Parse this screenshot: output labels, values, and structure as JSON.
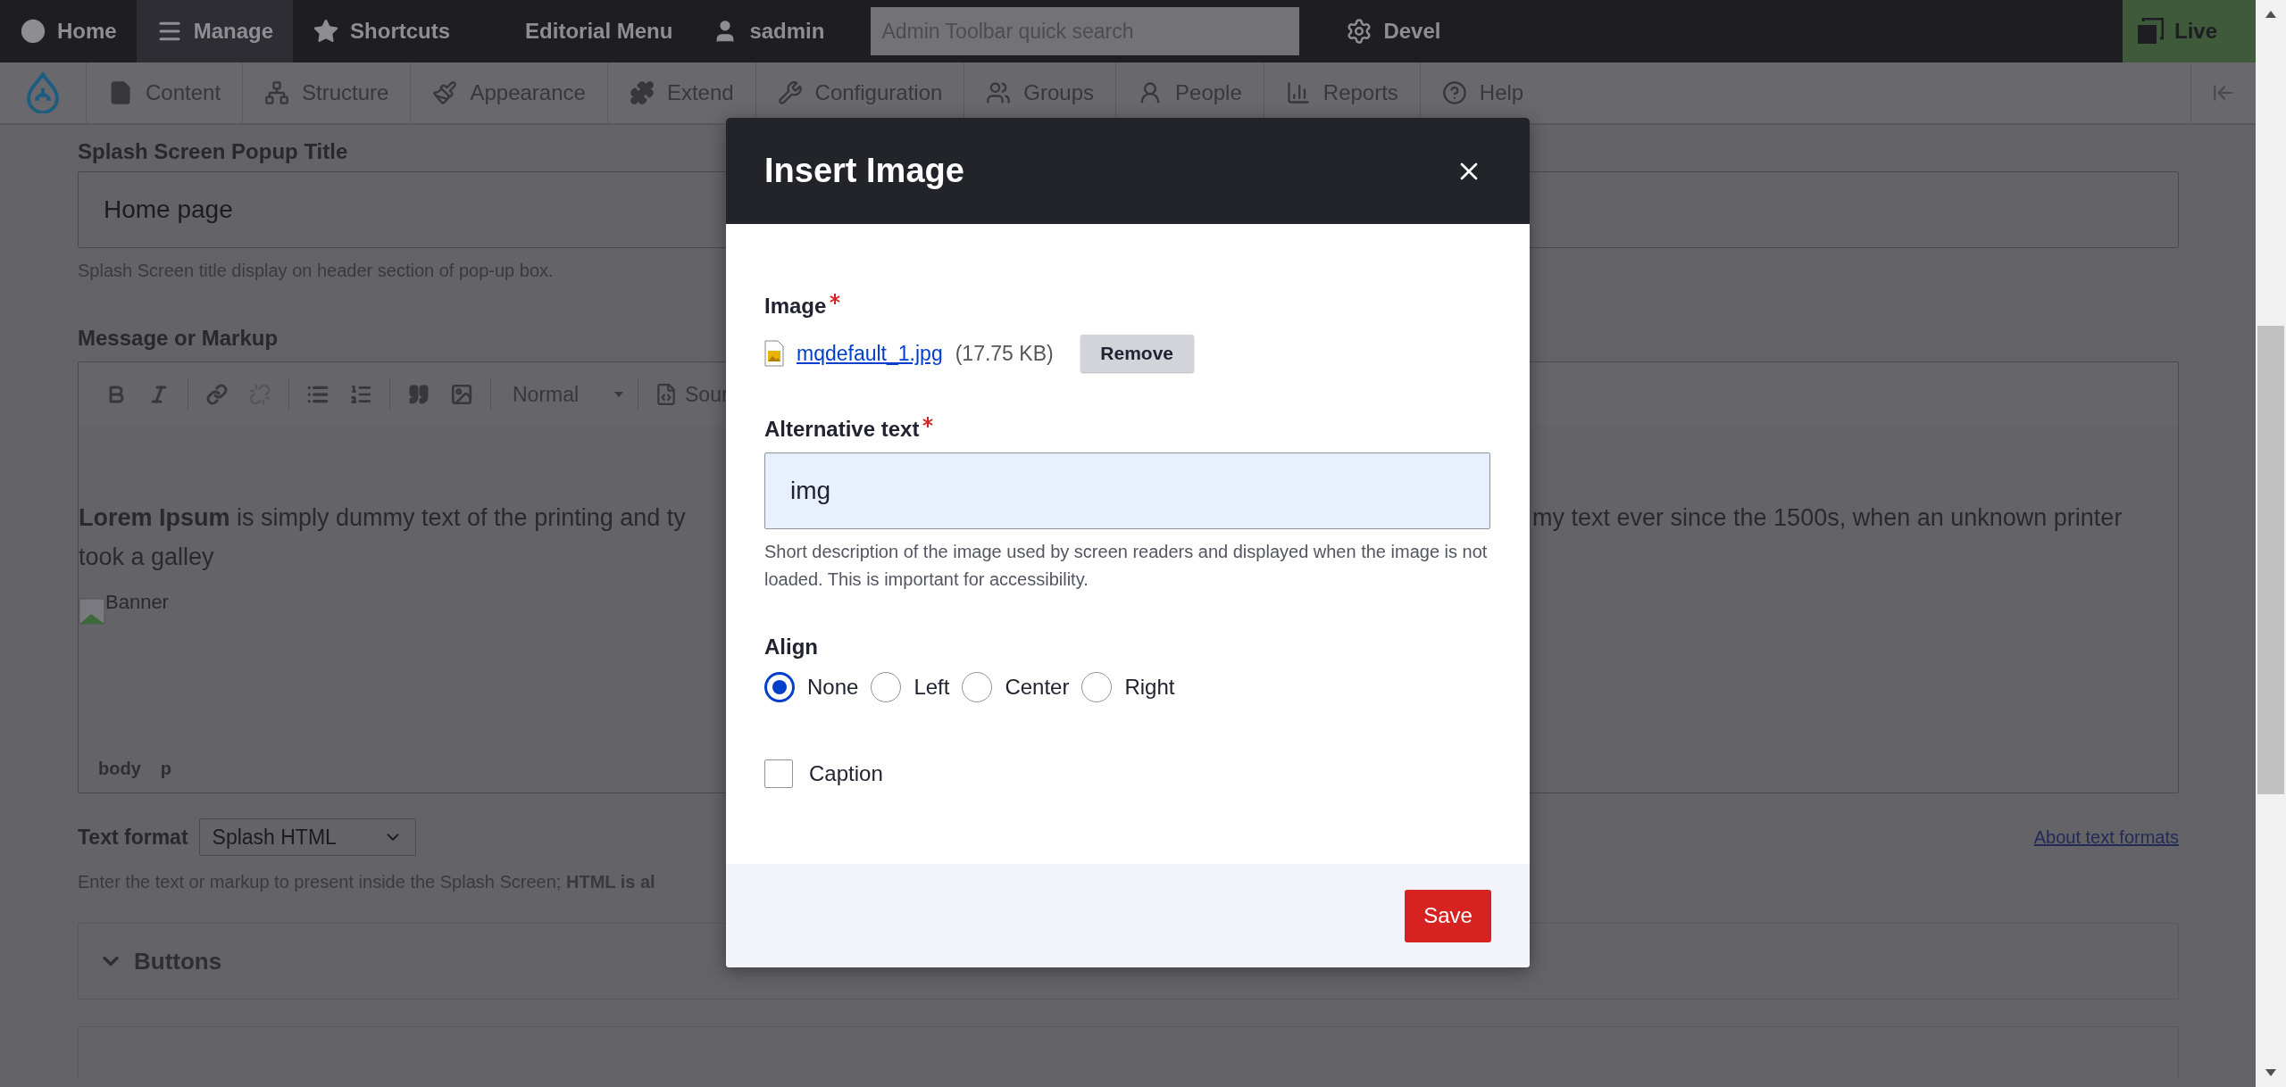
{
  "admin_toolbar": {
    "items": [
      {
        "label": "Home",
        "selected": false
      },
      {
        "label": "Manage",
        "selected": true
      },
      {
        "label": "Shortcuts",
        "selected": false
      },
      {
        "label": "Editorial Menu",
        "selected": false
      },
      {
        "label": "sadmin",
        "selected": false
      }
    ],
    "search": {
      "placeholder": "Admin Toolbar quick search"
    },
    "devel": "Devel",
    "live": "Live"
  },
  "menu": {
    "items": [
      "Content",
      "Structure",
      "Appearance",
      "Extend",
      "Configuration",
      "Groups",
      "People",
      "Reports",
      "Help"
    ]
  },
  "form": {
    "title_field": {
      "label": "Splash Screen Popup Title",
      "value": "Home page",
      "description": "Splash Screen title display on header section of pop-up box."
    },
    "message": {
      "label": "Message or Markup",
      "format": "Normal",
      "source": "Sour",
      "line1_left": "**Lorem Ipsum** is simply dummy text of the printing and ty",
      "line1_right": "my text ever since the 1500s, when an unknown printer",
      "line2": "took a galley",
      "image_alt": "Banner",
      "path": [
        "body",
        "p"
      ]
    },
    "text_format": {
      "label": "Text format",
      "value": "Splash HTML",
      "link": "About text formats",
      "description": "Enter the text or markup to present inside the Splash Screen; **HTML is al**"
    },
    "sections": [
      {
        "label": "Buttons"
      }
    ]
  },
  "dialog": {
    "title": "Insert Image",
    "image": {
      "label": "Image",
      "required": true,
      "file": "mqdefault_1.jpg",
      "size": "(17.75 KB)",
      "remove": "Remove"
    },
    "alt": {
      "label": "Alternative text",
      "required": true,
      "value": "img",
      "description": "Short description of the image used by screen readers and displayed when the image is not loaded. This is important for accessibility."
    },
    "align": {
      "label": "Align",
      "options": [
        {
          "label": "None",
          "selected": true
        },
        {
          "label": "Left",
          "selected": false
        },
        {
          "label": "Center",
          "selected": false
        },
        {
          "label": "Right",
          "selected": false
        }
      ]
    },
    "caption": {
      "label": "Caption",
      "checked": false
    },
    "save": "Save"
  }
}
